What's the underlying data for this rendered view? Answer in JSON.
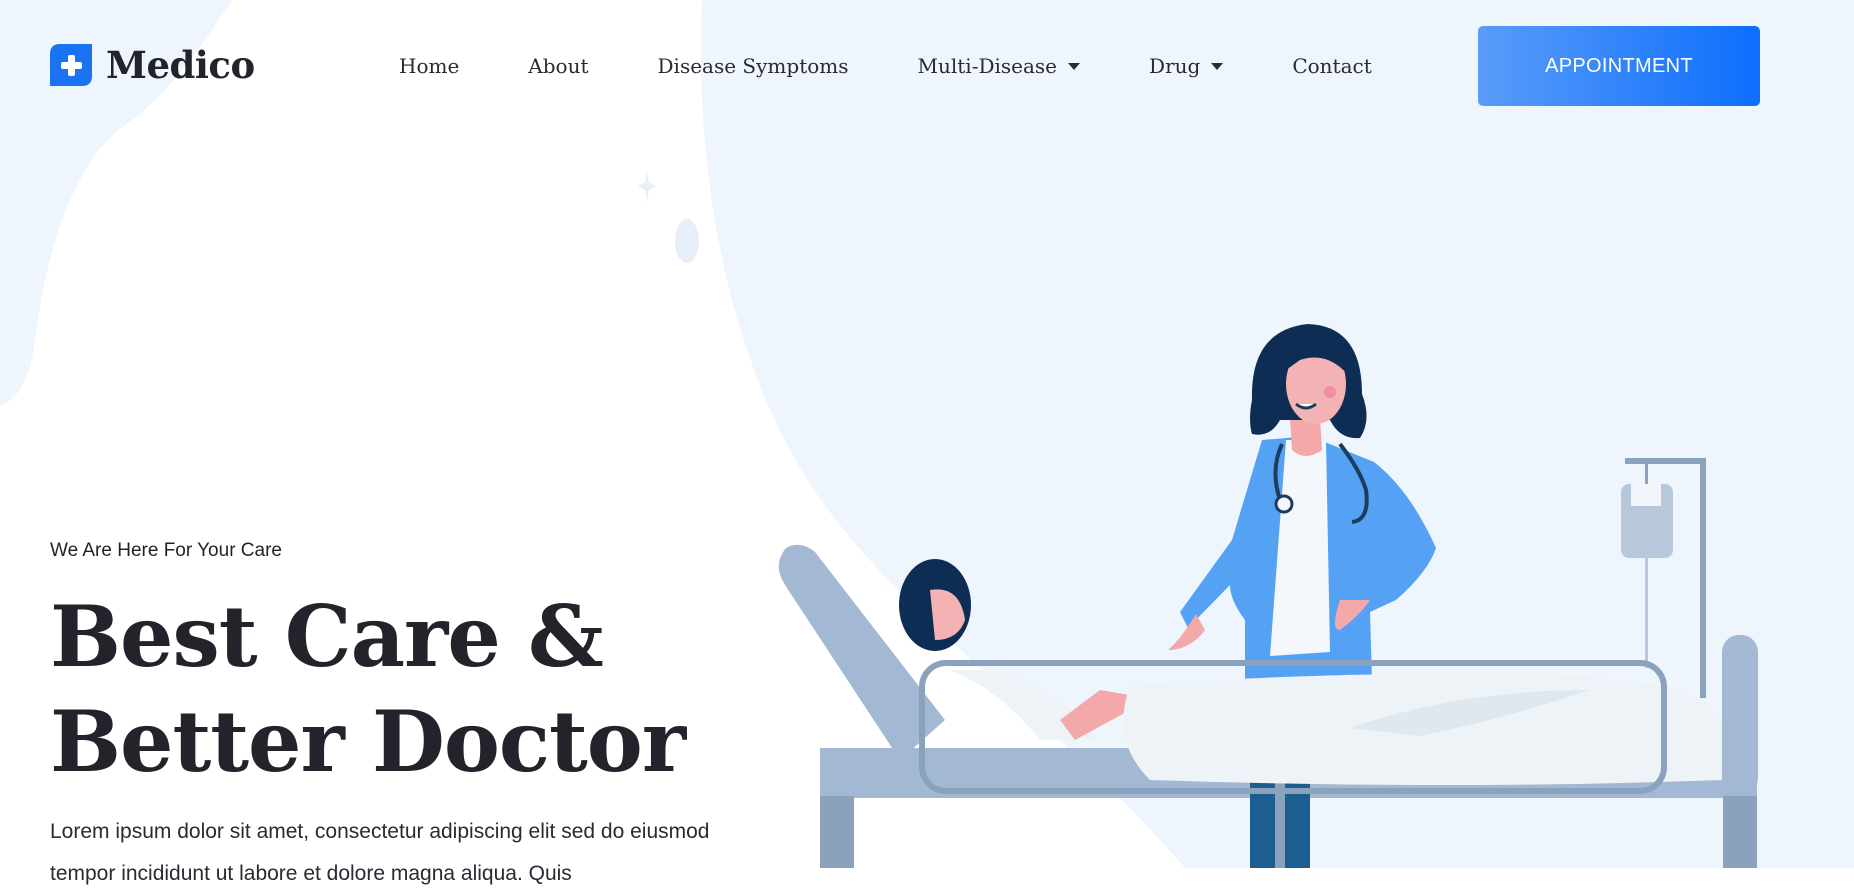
{
  "brand": {
    "name": "Medico",
    "accent": "#0d6efd",
    "logo_icon": "plus-cross-icon"
  },
  "nav": {
    "items": [
      {
        "label": "Home",
        "has_dropdown": false
      },
      {
        "label": "About",
        "has_dropdown": false
      },
      {
        "label": "Disease Symptoms",
        "has_dropdown": false
      },
      {
        "label": "Multi-Disease",
        "has_dropdown": true
      },
      {
        "label": "Drug",
        "has_dropdown": true
      },
      {
        "label": "Contact",
        "has_dropdown": false
      }
    ],
    "dropdown_icon": "caret-down-icon"
  },
  "cta": {
    "label": "APPOINTMENT"
  },
  "hero": {
    "kicker": "We Are Here For Your Care",
    "title_line1": "Best Care &",
    "title_line2": "Better Doctor",
    "description": "Lorem ipsum dolor sit amet, consectetur adipiscing elit sed do eiusmod tempor incididunt ut labore et dolore magna aliqua. Quis"
  },
  "colors": {
    "background_blob": "#eef5fd",
    "text_dark": "#23232b",
    "button_gradient_start": "#5a9cf9",
    "button_gradient_end": "#0d6efd"
  },
  "illustration": {
    "subject": "doctor-with-patient-in-hospital-bed"
  }
}
